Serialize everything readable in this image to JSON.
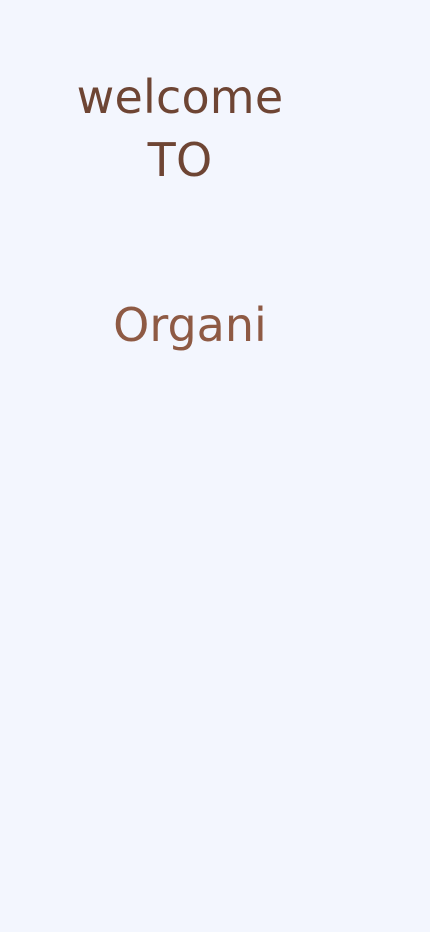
{
  "screen": {
    "background": "#f3f6fe",
    "welcome_line1": "welcome",
    "welcome_line2": "TO",
    "brand_name": "Organi",
    "welcome_color": "#6e4534",
    "brand_color": "#8e5a44"
  }
}
